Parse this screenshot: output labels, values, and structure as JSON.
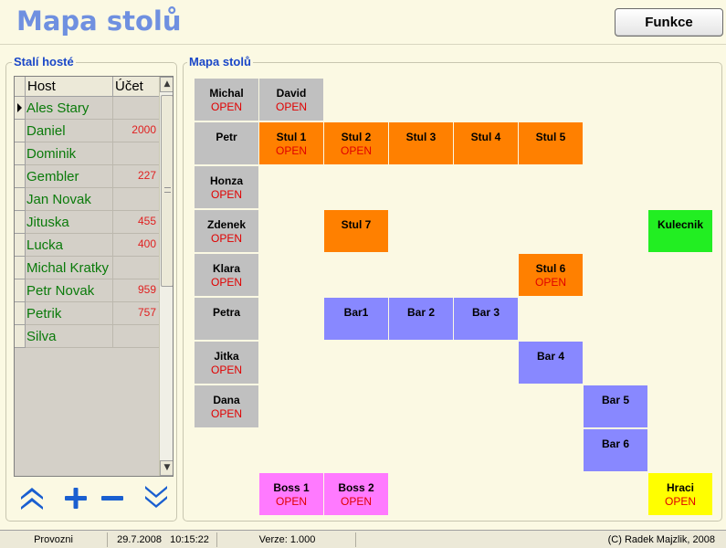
{
  "header": {
    "title": "Mapa stolů",
    "funkce_label": "Funkce"
  },
  "guests_panel": {
    "legend": "Stalí hosté",
    "columns": [
      "Host",
      "Účet"
    ],
    "rows": [
      {
        "host": "Ales Stary",
        "ucet": ""
      },
      {
        "host": "Daniel",
        "ucet": "2000"
      },
      {
        "host": "Dominik",
        "ucet": ""
      },
      {
        "host": "Gembler",
        "ucet": "227"
      },
      {
        "host": "Jan Novak",
        "ucet": ""
      },
      {
        "host": "Jituska",
        "ucet": "455"
      },
      {
        "host": "Lucka",
        "ucet": "400"
      },
      {
        "host": "Michal Kratky",
        "ucet": ""
      },
      {
        "host": "Petr Novak",
        "ucet": "959"
      },
      {
        "host": "Petrik",
        "ucet": "757"
      },
      {
        "host": "Silva",
        "ucet": ""
      }
    ],
    "selected_row": 0
  },
  "map_panel": {
    "legend": "Mapa stolů",
    "tiles": [
      {
        "name": "Michal",
        "status": "OPEN",
        "color": "gray",
        "col": 0,
        "row": 0
      },
      {
        "name": "David",
        "status": "OPEN",
        "color": "gray",
        "col": 1,
        "row": 0
      },
      {
        "name": "Petr",
        "status": "",
        "color": "gray",
        "col": 0,
        "row": 1
      },
      {
        "name": "Stul 1",
        "status": "OPEN",
        "color": "orange",
        "col": 1,
        "row": 1
      },
      {
        "name": "Stul 2",
        "status": "OPEN",
        "color": "orange",
        "col": 2,
        "row": 1
      },
      {
        "name": "Stul 3",
        "status": "",
        "color": "orange",
        "col": 3,
        "row": 1
      },
      {
        "name": "Stul 4",
        "status": "",
        "color": "orange",
        "col": 4,
        "row": 1
      },
      {
        "name": "Stul 5",
        "status": "",
        "color": "orange",
        "col": 5,
        "row": 1
      },
      {
        "name": "Honza",
        "status": "OPEN",
        "color": "gray",
        "col": 0,
        "row": 2
      },
      {
        "name": "Zdenek",
        "status": "OPEN",
        "color": "gray",
        "col": 0,
        "row": 3
      },
      {
        "name": "Stul 7",
        "status": "",
        "color": "orange",
        "col": 2,
        "row": 3
      },
      {
        "name": "Kulecnik",
        "status": "",
        "color": "green",
        "col": 7,
        "row": 3
      },
      {
        "name": "Klara",
        "status": "OPEN",
        "color": "gray",
        "col": 0,
        "row": 4
      },
      {
        "name": "Stul 6",
        "status": "OPEN",
        "color": "orange",
        "col": 5,
        "row": 4
      },
      {
        "name": "Petra",
        "status": "",
        "color": "gray",
        "col": 0,
        "row": 5
      },
      {
        "name": "Bar1",
        "status": "",
        "color": "blue",
        "col": 2,
        "row": 5
      },
      {
        "name": "Bar 2",
        "status": "",
        "color": "blue",
        "col": 3,
        "row": 5
      },
      {
        "name": "Bar 3",
        "status": "",
        "color": "blue",
        "col": 4,
        "row": 5
      },
      {
        "name": "Jitka",
        "status": "OPEN",
        "color": "gray",
        "col": 0,
        "row": 6
      },
      {
        "name": "Bar 4",
        "status": "",
        "color": "blue",
        "col": 5,
        "row": 6
      },
      {
        "name": "Dana",
        "status": "OPEN",
        "color": "gray",
        "col": 0,
        "row": 7
      },
      {
        "name": "Bar 5",
        "status": "",
        "color": "blue",
        "col": 6,
        "row": 7
      },
      {
        "name": "Bar 6",
        "status": "",
        "color": "blue",
        "col": 6,
        "row": 8
      },
      {
        "name": "Boss 1",
        "status": "OPEN",
        "color": "pink",
        "col": 1,
        "row": 9
      },
      {
        "name": "Boss 2",
        "status": "OPEN",
        "color": "pink",
        "col": 2,
        "row": 9
      },
      {
        "name": "Hraci",
        "status": "OPEN",
        "color": "yellow",
        "col": 7,
        "row": 9
      }
    ]
  },
  "nav_icons": [
    "double-chevron-up-icon",
    "plus-icon",
    "minus-icon",
    "double-chevron-down-icon"
  ],
  "colors": {
    "accent": "#1a47c8",
    "title": "#6f90e0",
    "nav_icon": "#1a5fd0"
  },
  "statusbar": {
    "mode": "Provozni",
    "date": "29.7.2008",
    "time": "10:15:22",
    "version": "Verze: 1.000",
    "copyright": "(C) Radek Majzlik, 2008"
  }
}
